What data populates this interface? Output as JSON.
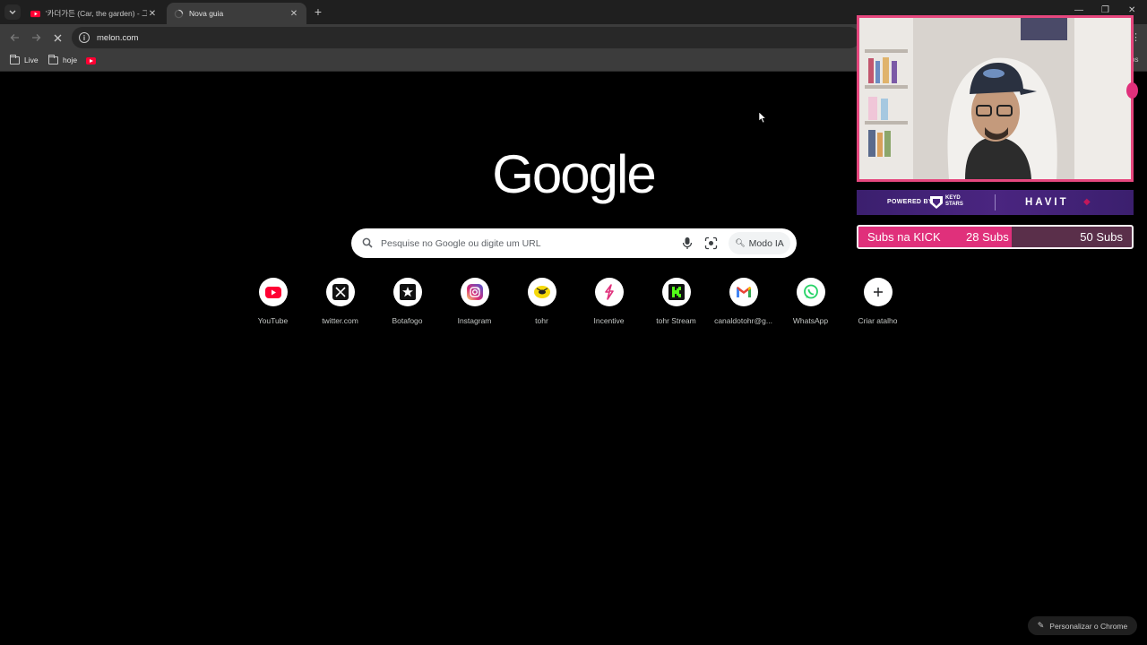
{
  "browser": {
    "tabs": [
      {
        "title": "'카더가든 (Car, the garden) - 그",
        "active": false,
        "favicon": "youtube-icon"
      },
      {
        "title": "Nova guia",
        "active": true,
        "favicon": "loading-spinner-icon"
      }
    ],
    "address_bar": {
      "url": "melon.com"
    },
    "bookmarks": [
      {
        "label": "Live",
        "icon": "folder-icon"
      },
      {
        "label": "hoje",
        "icon": "folder-icon"
      },
      {
        "label": "",
        "icon": "youtube-icon"
      }
    ],
    "bookmarks_right_text": "os"
  },
  "ntp": {
    "logo_text": "Google",
    "search": {
      "placeholder": "Pesquise no Google ou digite um URL",
      "ai_mode_label": "Modo IA"
    },
    "shortcuts": [
      {
        "label": "YouTube",
        "icon": "youtube-icon"
      },
      {
        "label": "twitter.com",
        "icon": "x-icon"
      },
      {
        "label": "Botafogo",
        "icon": "botafogo-star-icon"
      },
      {
        "label": "Instagram",
        "icon": "instagram-icon"
      },
      {
        "label": "tohr",
        "icon": "tohr-icon"
      },
      {
        "label": "Incentive",
        "icon": "incentive-icon"
      },
      {
        "label": "tohr Stream",
        "icon": "kick-icon"
      },
      {
        "label": "canaldotohr@g...",
        "icon": "gmail-icon"
      },
      {
        "label": "WhatsApp",
        "icon": "whatsapp-icon"
      },
      {
        "label": "Criar atalho",
        "icon": "plus-icon"
      }
    ],
    "customize_label": "Personalizar o Chrome"
  },
  "overlay": {
    "sponsor": {
      "powered_by": "POWERED BY",
      "keyd_line1": "KEYD",
      "keyd_line2": "STARS",
      "brand": "HAVIT"
    },
    "sub_goal": {
      "label": "Subs na KICK",
      "current": "28 Subs",
      "goal": "50 Subs",
      "progress": 0.56
    },
    "colors": {
      "accent": "#e0307b",
      "border": "#e6477e",
      "sponsor_bg": "#4a2580"
    }
  }
}
